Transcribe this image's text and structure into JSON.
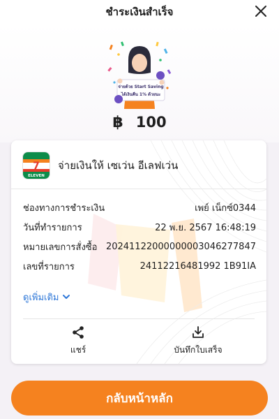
{
  "header": {
    "title": "ชำระเงินสำเร็จ",
    "close_icon": "close-icon"
  },
  "promo": {
    "line1": "จ่ายด้วย Start Saving",
    "line2": "ได้เงินคืน 1% ด้วยนะ"
  },
  "amount": {
    "currency_symbol": "฿",
    "value": "100"
  },
  "merchant": {
    "logo_text": "ELEVEN",
    "logo_number": "7",
    "name": "จ่ายเงินให้ เซเว่น อีเลฟเว่น"
  },
  "details": [
    {
      "label": "ช่องทางการชำระเงิน",
      "value": "เพย์ เน็กซ์0344"
    },
    {
      "label": "วันที่ทำรายการ",
      "value": "22 พ.ย. 2567 16:48:19"
    },
    {
      "label": "หมายเลขการสั่งซื้อ",
      "value": "20241122000000003046277847"
    },
    {
      "label": "เลขที่รายการ",
      "value": "24112216481992 1B91IA"
    }
  ],
  "more": {
    "label": "ดูเพิ่มเติม",
    "icon": "chevron-down-icon"
  },
  "actions": {
    "share_label": "แชร์",
    "share_icon": "share-icon",
    "save_label": "บันทึกใบเสร็จ",
    "save_icon": "download-icon"
  },
  "footer": {
    "home_label": "กลับหน้าหลัก"
  },
  "colors": {
    "accent": "#f5821f",
    "link": "#2f78d8",
    "seven_green": "#0d8c4a",
    "seven_red": "#e53b2c",
    "seven_orange": "#f5821f"
  }
}
